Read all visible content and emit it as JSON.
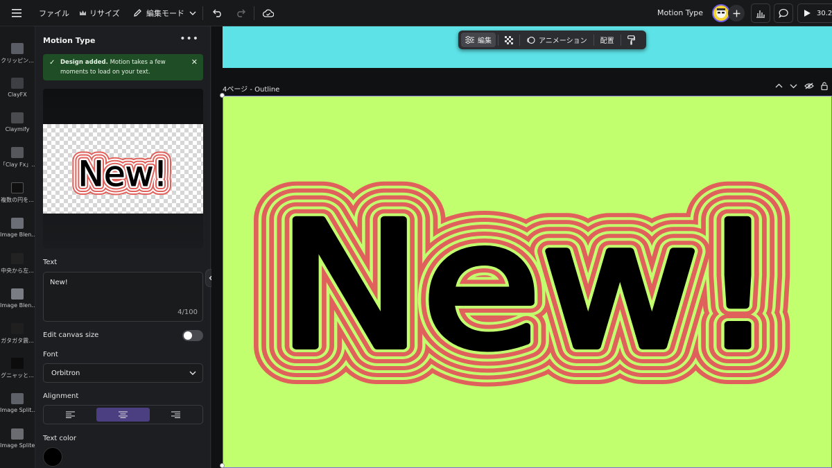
{
  "topbar": {
    "file_label": "ファイル",
    "resize_label": "リサイズ",
    "edit_mode_label": "編集モード",
    "project_title": "Motion Type",
    "zoom_text": "30.2"
  },
  "rail": {
    "items": [
      {
        "label": "クリッピン..."
      },
      {
        "label": "ClayFX"
      },
      {
        "label": "Claymify"
      },
      {
        "label": "「Clay Fx」..."
      },
      {
        "label": "複数の円を..."
      },
      {
        "label": "Image Blen..."
      },
      {
        "label": "中央から左..."
      },
      {
        "label": "Image Blen..."
      },
      {
        "label": "ガタガタ震..."
      },
      {
        "label": "グニャッと..."
      },
      {
        "label": "Image Split..."
      },
      {
        "label": "Image Spliter"
      }
    ]
  },
  "panel": {
    "title": "Motion Type",
    "more": "•••",
    "toast": {
      "bold": "Design added.",
      "text": " Motion takes a few moments to load on your text."
    },
    "preview_text": "New!",
    "text_label": "Text",
    "text_value": "New!",
    "char_count": "4/100",
    "edit_canvas_label": "Edit canvas size",
    "font_label": "Font",
    "font_value": "Orbitron",
    "alignment_label": "Alignment",
    "alignment_selected": "center",
    "text_color_label": "Text color",
    "text_color": "#000000"
  },
  "canvas": {
    "toolbar": {
      "edit_label": "編集",
      "animation_label": "アニメーション",
      "arrange_label": "配置"
    },
    "page_label": "4ページ - Outline",
    "top_page_color": "#5de2e7",
    "page_color": "#c2ff6e",
    "outline_color": "#e0615b",
    "text": "New!"
  }
}
